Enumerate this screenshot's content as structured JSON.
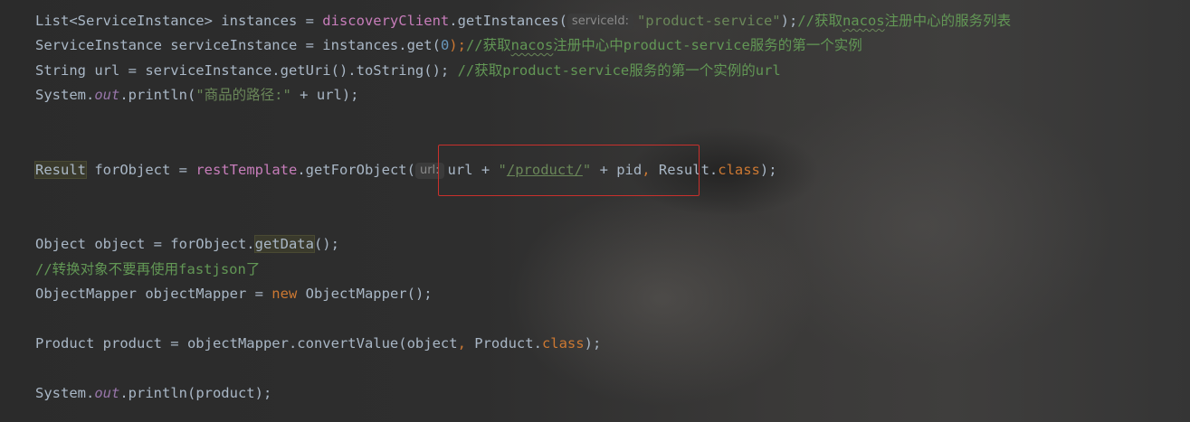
{
  "code": {
    "l1": {
      "p1": "List<ServiceInstance> instances = ",
      "p2": "discoveryClient",
      "p3": ".getInstances(",
      "hint": "serviceId:",
      "str": "\"product-service\"",
      "p4": ");",
      "c1": "//获取",
      "c2": "nacos",
      "c3": "注册中心的服务列表"
    },
    "l2": {
      "p1": "ServiceInstance serviceInstance = instances.get(",
      "num": "0",
      "p2": ");",
      "c1": "//获取",
      "c2": "nacos",
      "c3": "注册中心中product-service服务的第一个实例"
    },
    "l3": {
      "p1": "String url = serviceInstance.getUri().toString(); ",
      "cmt": "//获取product-service服务的第一个实例的url"
    },
    "l4": {
      "p1": "System.",
      "stat": "out",
      "p2": ".println(",
      "str": "\"商品的路径:\"",
      "p3": " + url);"
    },
    "l5": {
      "type": "Result",
      "p1": " forObject = ",
      "p2": "restTemplate",
      "p3": ".getForObject(",
      "hint": "url:",
      "p4": "url + ",
      "s1": "\"",
      "s2": "/product/",
      "s3": "\"",
      "p5": " + pid",
      "comma": ",",
      "p6": " Result.",
      "kw": "class",
      "p7": ");"
    },
    "l6": {
      "p1": "Object object = forObject.",
      "method": "getData",
      "p2": "();"
    },
    "l7": {
      "cmt": "//转换对象不要再使用fastjson了"
    },
    "l8": {
      "p1": "ObjectMapper objectMapper = ",
      "kw": "new",
      "p2": " ObjectMapper();"
    },
    "l9": {
      "p1": "Product product = objectMapper.convertValue(object",
      "comma": ",",
      "p2": " Product.",
      "kw": "class",
      "p3": ");"
    },
    "l10": {
      "p1": "System.",
      "stat": "out",
      "p2": ".println(product);"
    }
  },
  "colors": {
    "background": "#2b2b2b",
    "text": "#a9b7c6",
    "keyword": "#cc7832",
    "field": "#c77dba",
    "string": "#6a8759",
    "number": "#6897bb",
    "comment": "#629755",
    "static": "#9876aa",
    "highlight_box": "#c9302c"
  }
}
